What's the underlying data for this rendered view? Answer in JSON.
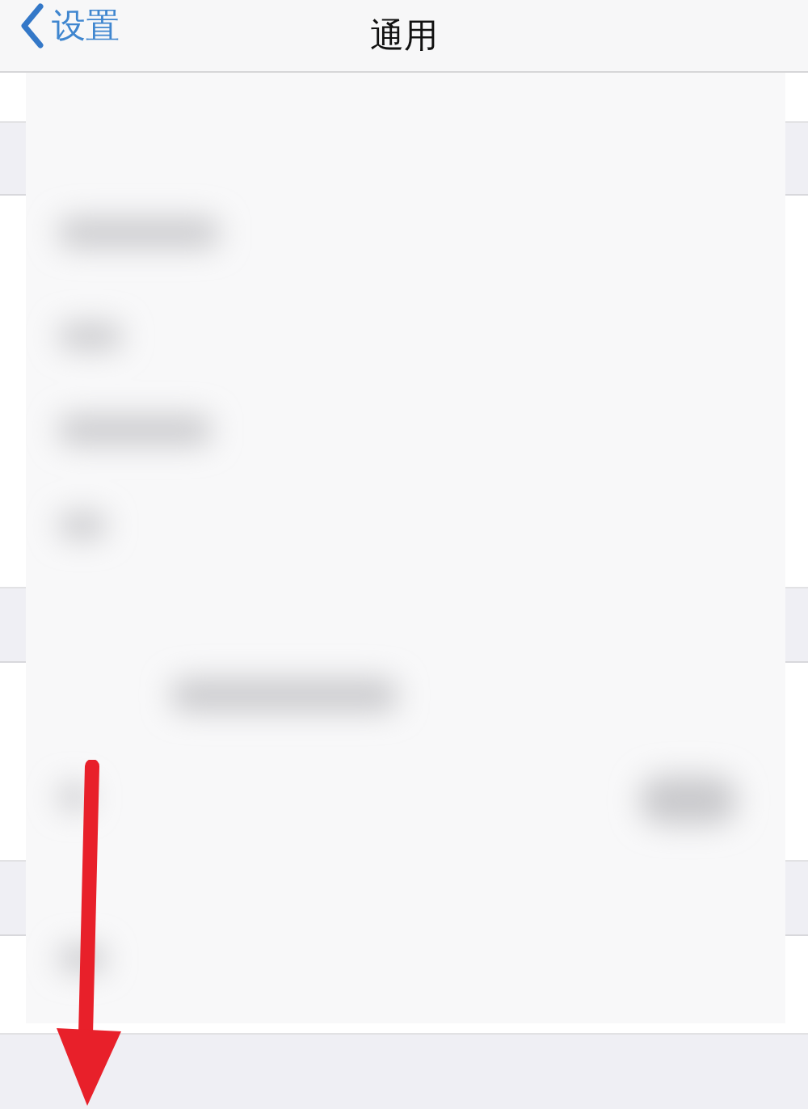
{
  "nav_bar": {
    "back_label": "设置",
    "title": "通用"
  }
}
